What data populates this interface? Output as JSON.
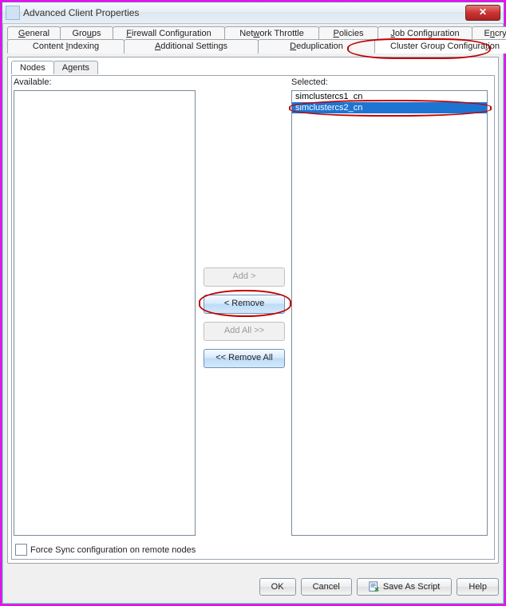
{
  "window": {
    "title": "Advanced Client Properties"
  },
  "outerTabs": {
    "row1": [
      {
        "pre": "",
        "u": "G",
        "post": "eneral"
      },
      {
        "pre": "Gro",
        "u": "u",
        "post": "ps"
      },
      {
        "pre": "",
        "u": "F",
        "post": "irewall Configuration"
      },
      {
        "pre": "Net",
        "u": "w",
        "post": "ork Throttle"
      },
      {
        "pre": "",
        "u": "P",
        "post": "olicies"
      },
      {
        "pre": "",
        "u": "J",
        "post": "ob Configuration"
      },
      {
        "pre": "E",
        "u": "n",
        "post": "cryption"
      }
    ],
    "row2": [
      {
        "pre": "Content ",
        "u": "I",
        "post": "ndexing"
      },
      {
        "pre": "",
        "u": "A",
        "post": "dditional Settings"
      },
      {
        "pre": "",
        "u": "D",
        "post": "eduplication"
      },
      {
        "pre": "Cluster Group Configura",
        "u": "t",
        "post": "ion"
      }
    ],
    "activeRow2Index": 3
  },
  "innerTabs": {
    "items": [
      "Nodes",
      "Agents"
    ],
    "activeIndex": 0
  },
  "labels": {
    "available": "Available:",
    "selected": "Selected:"
  },
  "available": [],
  "selected": [
    {
      "text": "simclustercs1_cn",
      "selected": false
    },
    {
      "text": "simclustercs2_cn",
      "selected": true
    }
  ],
  "transfer": {
    "add": "Add >",
    "remove": "< Remove",
    "addAll": "Add All >>",
    "removeAll": "<< Remove All",
    "addEnabled": false,
    "removeEnabled": true,
    "addAllEnabled": false,
    "removeAllEnabled": true
  },
  "checkbox": {
    "label": "Force Sync configuration on remote nodes",
    "checked": false
  },
  "dialogButtons": {
    "ok": "OK",
    "cancel": "Cancel",
    "saveAsScript": "Save As Script",
    "help": "Help"
  }
}
